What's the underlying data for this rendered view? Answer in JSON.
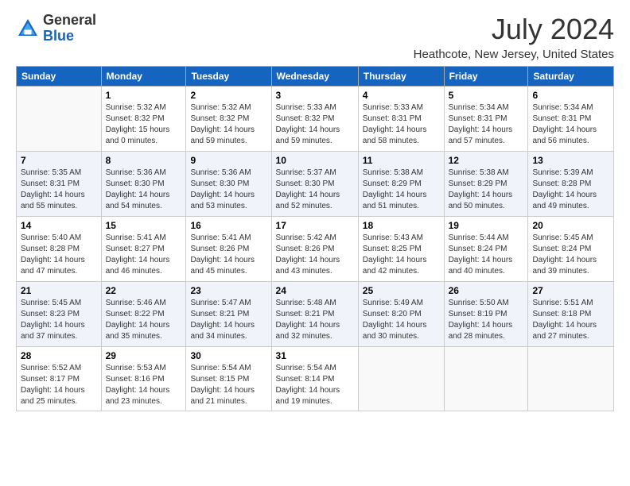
{
  "header": {
    "logo_general": "General",
    "logo_blue": "Blue",
    "month_year": "July 2024",
    "location": "Heathcote, New Jersey, United States"
  },
  "weekdays": [
    "Sunday",
    "Monday",
    "Tuesday",
    "Wednesday",
    "Thursday",
    "Friday",
    "Saturday"
  ],
  "weeks": [
    [
      {
        "day": "",
        "info": ""
      },
      {
        "day": "1",
        "info": "Sunrise: 5:32 AM\nSunset: 8:32 PM\nDaylight: 15 hours\nand 0 minutes."
      },
      {
        "day": "2",
        "info": "Sunrise: 5:32 AM\nSunset: 8:32 PM\nDaylight: 14 hours\nand 59 minutes."
      },
      {
        "day": "3",
        "info": "Sunrise: 5:33 AM\nSunset: 8:32 PM\nDaylight: 14 hours\nand 59 minutes."
      },
      {
        "day": "4",
        "info": "Sunrise: 5:33 AM\nSunset: 8:31 PM\nDaylight: 14 hours\nand 58 minutes."
      },
      {
        "day": "5",
        "info": "Sunrise: 5:34 AM\nSunset: 8:31 PM\nDaylight: 14 hours\nand 57 minutes."
      },
      {
        "day": "6",
        "info": "Sunrise: 5:34 AM\nSunset: 8:31 PM\nDaylight: 14 hours\nand 56 minutes."
      }
    ],
    [
      {
        "day": "7",
        "info": "Sunrise: 5:35 AM\nSunset: 8:31 PM\nDaylight: 14 hours\nand 55 minutes."
      },
      {
        "day": "8",
        "info": "Sunrise: 5:36 AM\nSunset: 8:30 PM\nDaylight: 14 hours\nand 54 minutes."
      },
      {
        "day": "9",
        "info": "Sunrise: 5:36 AM\nSunset: 8:30 PM\nDaylight: 14 hours\nand 53 minutes."
      },
      {
        "day": "10",
        "info": "Sunrise: 5:37 AM\nSunset: 8:30 PM\nDaylight: 14 hours\nand 52 minutes."
      },
      {
        "day": "11",
        "info": "Sunrise: 5:38 AM\nSunset: 8:29 PM\nDaylight: 14 hours\nand 51 minutes."
      },
      {
        "day": "12",
        "info": "Sunrise: 5:38 AM\nSunset: 8:29 PM\nDaylight: 14 hours\nand 50 minutes."
      },
      {
        "day": "13",
        "info": "Sunrise: 5:39 AM\nSunset: 8:28 PM\nDaylight: 14 hours\nand 49 minutes."
      }
    ],
    [
      {
        "day": "14",
        "info": "Sunrise: 5:40 AM\nSunset: 8:28 PM\nDaylight: 14 hours\nand 47 minutes."
      },
      {
        "day": "15",
        "info": "Sunrise: 5:41 AM\nSunset: 8:27 PM\nDaylight: 14 hours\nand 46 minutes."
      },
      {
        "day": "16",
        "info": "Sunrise: 5:41 AM\nSunset: 8:26 PM\nDaylight: 14 hours\nand 45 minutes."
      },
      {
        "day": "17",
        "info": "Sunrise: 5:42 AM\nSunset: 8:26 PM\nDaylight: 14 hours\nand 43 minutes."
      },
      {
        "day": "18",
        "info": "Sunrise: 5:43 AM\nSunset: 8:25 PM\nDaylight: 14 hours\nand 42 minutes."
      },
      {
        "day": "19",
        "info": "Sunrise: 5:44 AM\nSunset: 8:24 PM\nDaylight: 14 hours\nand 40 minutes."
      },
      {
        "day": "20",
        "info": "Sunrise: 5:45 AM\nSunset: 8:24 PM\nDaylight: 14 hours\nand 39 minutes."
      }
    ],
    [
      {
        "day": "21",
        "info": "Sunrise: 5:45 AM\nSunset: 8:23 PM\nDaylight: 14 hours\nand 37 minutes."
      },
      {
        "day": "22",
        "info": "Sunrise: 5:46 AM\nSunset: 8:22 PM\nDaylight: 14 hours\nand 35 minutes."
      },
      {
        "day": "23",
        "info": "Sunrise: 5:47 AM\nSunset: 8:21 PM\nDaylight: 14 hours\nand 34 minutes."
      },
      {
        "day": "24",
        "info": "Sunrise: 5:48 AM\nSunset: 8:21 PM\nDaylight: 14 hours\nand 32 minutes."
      },
      {
        "day": "25",
        "info": "Sunrise: 5:49 AM\nSunset: 8:20 PM\nDaylight: 14 hours\nand 30 minutes."
      },
      {
        "day": "26",
        "info": "Sunrise: 5:50 AM\nSunset: 8:19 PM\nDaylight: 14 hours\nand 28 minutes."
      },
      {
        "day": "27",
        "info": "Sunrise: 5:51 AM\nSunset: 8:18 PM\nDaylight: 14 hours\nand 27 minutes."
      }
    ],
    [
      {
        "day": "28",
        "info": "Sunrise: 5:52 AM\nSunset: 8:17 PM\nDaylight: 14 hours\nand 25 minutes."
      },
      {
        "day": "29",
        "info": "Sunrise: 5:53 AM\nSunset: 8:16 PM\nDaylight: 14 hours\nand 23 minutes."
      },
      {
        "day": "30",
        "info": "Sunrise: 5:54 AM\nSunset: 8:15 PM\nDaylight: 14 hours\nand 21 minutes."
      },
      {
        "day": "31",
        "info": "Sunrise: 5:54 AM\nSunset: 8:14 PM\nDaylight: 14 hours\nand 19 minutes."
      },
      {
        "day": "",
        "info": ""
      },
      {
        "day": "",
        "info": ""
      },
      {
        "day": "",
        "info": ""
      }
    ]
  ]
}
